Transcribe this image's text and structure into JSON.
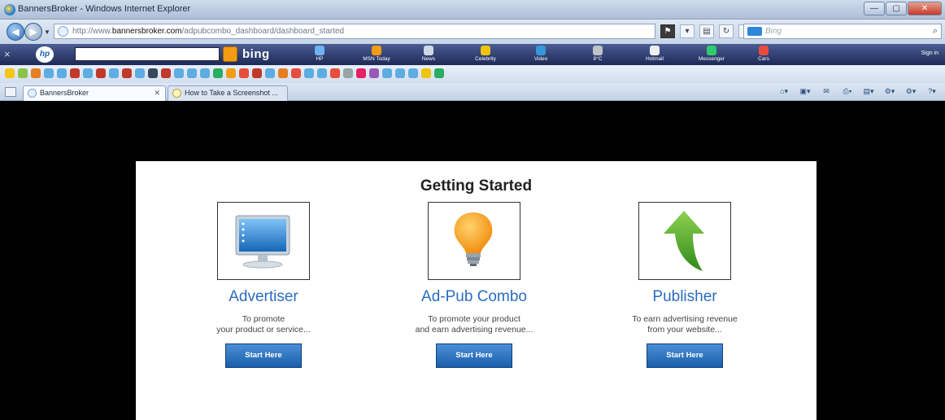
{
  "window": {
    "title": "BannersBroker - Windows Internet Explorer",
    "buttons": [
      "—",
      "▢",
      "✕"
    ]
  },
  "address_bar": {
    "url_prefix": "http://www.",
    "url_domain": "bannersbroker.com",
    "url_path": "/adpubcombo_dashboard/dashboard_started",
    "search_placeholder": "Bing",
    "search_icon": "search-icon"
  },
  "hp_toolbar": {
    "close": "×",
    "logo": "hp",
    "bing_label": "bing",
    "items": [
      "HP",
      "MSN Today",
      "News",
      "Celebrity",
      "Video",
      "8°C",
      "Hotmail",
      "Messenger",
      "Cars"
    ],
    "sign_in": "Sign in"
  },
  "tabs": [
    {
      "label": "BannersBroker",
      "active": true
    },
    {
      "label": "How to Take a Screenshot ...",
      "active": false
    }
  ],
  "page": {
    "heading": "Getting Started",
    "cards": [
      {
        "title": "Advertiser",
        "line1": "To promote",
        "line2": "your product or service...",
        "button": "Start Here",
        "icon": "monitor-icon"
      },
      {
        "title": "Ad-Pub Combo",
        "line1": "To promote your product",
        "line2": "and earn advertising revenue...",
        "button": "Start Here",
        "icon": "lightbulb-icon"
      },
      {
        "title": "Publisher",
        "line1": "To earn advertising revenue",
        "line2": "from your website...",
        "button": "Start Here",
        "icon": "up-arrow-icon"
      }
    ]
  },
  "colors": {
    "accent": "#2b6dbf",
    "button": "#1a5fab",
    "background": "#000000"
  }
}
